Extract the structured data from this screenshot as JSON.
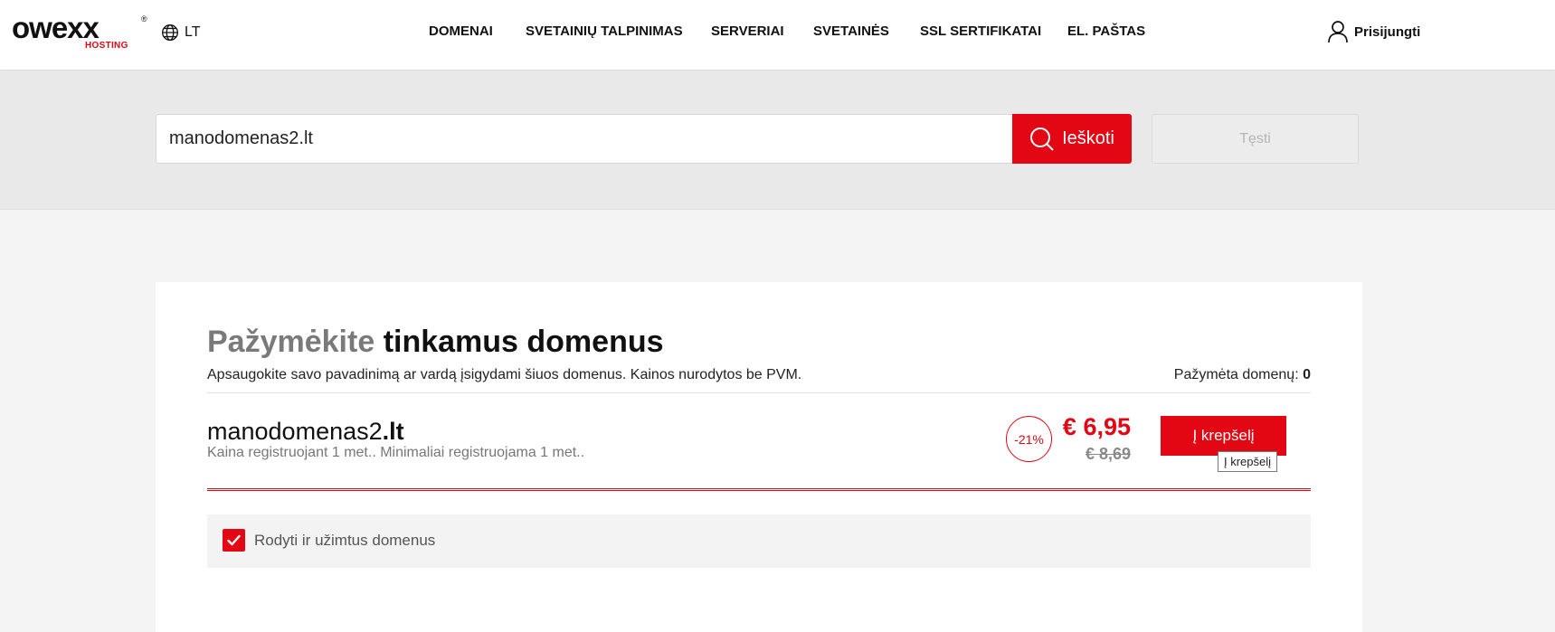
{
  "header": {
    "logo_text": "owexx",
    "logo_sub": "HOSTING",
    "logo_reg": "®",
    "language": "LT",
    "nav": [
      {
        "label": "DOMENAI"
      },
      {
        "label": "SVETAINIŲ TALPINIMAS"
      },
      {
        "label": "SERVERIAI"
      },
      {
        "label": "SVETAINĖS"
      },
      {
        "label": "SSL SERTIFIKATAI"
      },
      {
        "label": "EL. PAŠTAS"
      }
    ],
    "login_label": "Prisijungti"
  },
  "search": {
    "value": "manodomenas2.lt",
    "button_label": "Ieškoti",
    "continue_label": "Tęsti"
  },
  "results": {
    "title_muted": "Pažymėkite",
    "title_main": "tinkamus domenus",
    "subtitle": "Apsaugokite savo pavadinimą ar vardą įsigydami šiuos domenus. Kainos nurodytos be PVM.",
    "selected_label": "Pažymėta domenų:",
    "selected_count": "0",
    "domains": [
      {
        "name": "manodomenas2",
        "tld": ".lt",
        "meta": "Kaina registruojant 1 met.. Minimaliai registruojama 1 met..",
        "discount": "-21%",
        "price_new": "€ 6,95",
        "price_old": "€ 8,69",
        "cart_label": "Į krepšelį",
        "tooltip": "Į krepšelį"
      }
    ],
    "filter_label": "Rodyti ir užimtus domenus",
    "filter_checked": true
  },
  "colors": {
    "brand_red": "#e30613",
    "header_bg": "#ffffff",
    "band_bg": "#e9e9e9"
  }
}
